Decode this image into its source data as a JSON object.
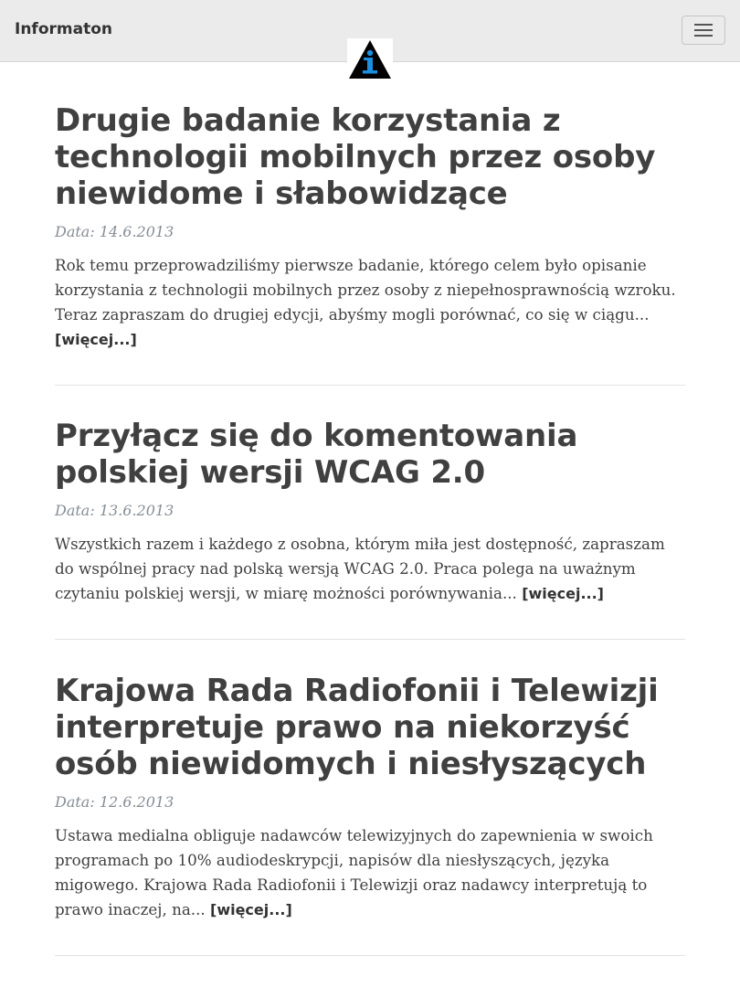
{
  "navbar": {
    "brand": "Informaton",
    "toggle_icon": "hamburger-menu-icon",
    "logo_icon": "information-logo-icon"
  },
  "colors": {
    "navbar_bg": "#ebebeb",
    "title_text": "#404040",
    "date_text": "#868e96",
    "logo_blue": "#1a8fe0",
    "logo_black": "#000000"
  },
  "posts": [
    {
      "title": "Drugie badanie korzystania z technologii mobilnych przez osoby niewidome i słabowidzące",
      "date": "Data: 14.6.2013",
      "excerpt": "Rok temu przeprowadziliśmy pierwsze badanie, którego celem było opisanie korzystania z technologii mobilnych przez osoby z niepełnosprawnością wzroku. Teraz zapraszam do drugiej edycji, abyśmy mogli porównać, co się w ciągu...",
      "more": "[więcej...]"
    },
    {
      "title": "Przyłącz się do komentowania polskiej wersji WCAG 2.0",
      "date": "Data: 13.6.2013",
      "excerpt": "Wszystkich razem i każdego z osobna, którym miła jest dostępność, zapraszam do wspólnej pracy nad polską wersją WCAG 2.0. Praca polega na uważnym czytaniu polskiej wersji, w miarę możności porównywania...",
      "more": "[więcej...]"
    },
    {
      "title": "Krajowa Rada Radiofonii i Telewizji interpretuje prawo na niekorzyść osób niewidomych i niesłyszących",
      "date": "Data: 12.6.2013",
      "excerpt": "Ustawa medialna obliguje nadawców telewizyjnych do zapewnienia w swoich programach po 10% audiodeskrypcji, napisów dla niesłyszących, języka migowego. Krajowa Rada Radiofonii i Telewizji oraz nadawcy interpretują to prawo inaczej, na...",
      "more": "[więcej...]"
    }
  ]
}
